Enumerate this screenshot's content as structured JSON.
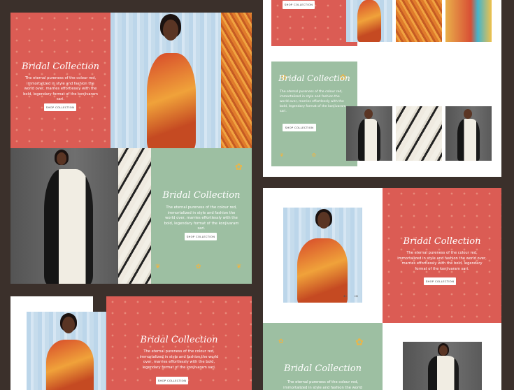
{
  "collection": {
    "title": "Bridal Collection",
    "description": "The eternal pureness of the colour red, immortalized in style and fashion the world over, marries effortlessly with the bold, legendary format of the konjivaram sari.",
    "button": "SHOP COLLECTION"
  },
  "carousel": {
    "prev": "←",
    "next": "→"
  },
  "colors": {
    "red": "#db5c54",
    "green": "#9dbfa2",
    "background": "#3b302b",
    "gold": "#e9b64a"
  }
}
